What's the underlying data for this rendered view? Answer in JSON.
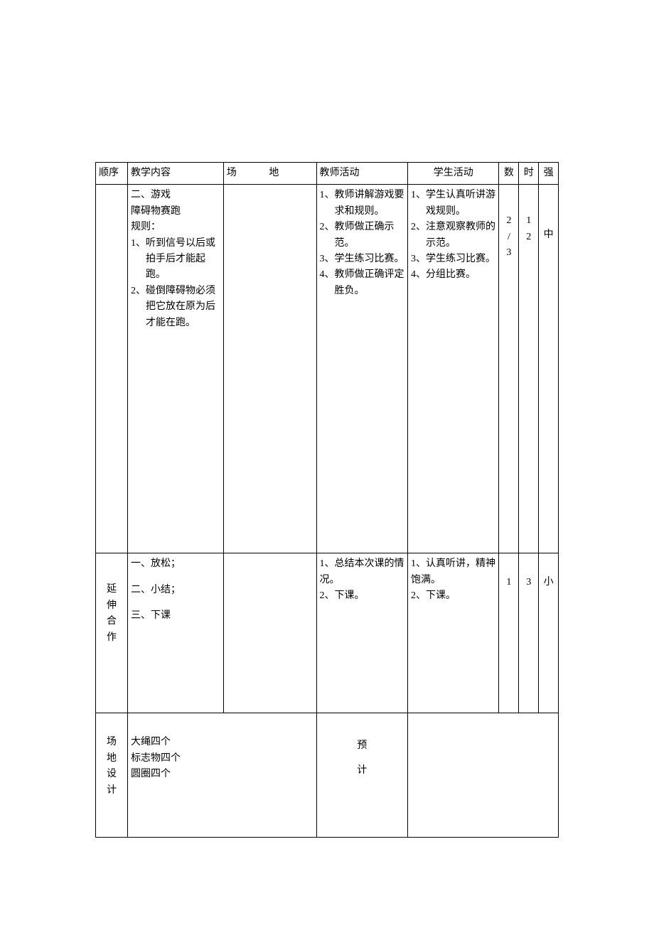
{
  "headers": {
    "seq": "顺序",
    "content": "教学内容",
    "field": "场   地",
    "teacher": "教师活动",
    "student": "学生活动",
    "num": "数",
    "time": "时",
    "inten": "强"
  },
  "row1": {
    "content": {
      "title": "二、游戏",
      "subtitle1": "障碍物赛跑",
      "subtitle2": "规则：",
      "items": [
        {
          "idx": "1、",
          "txt": "听到信号以后或拍手后才能起跑。"
        },
        {
          "idx": "2、",
          "txt": "碰倒障碍物必须把它放在原为后才能在跑。"
        }
      ]
    },
    "teacher": [
      {
        "idx": "1、",
        "txt": "教师讲解游戏要求和规则。"
      },
      {
        "idx": "2、",
        "txt": "教师做正确示范。"
      },
      {
        "idx": "3、",
        "txt": "学生练习比赛。"
      },
      {
        "idx": "4、",
        "txt": "教师做正确评定胜负。"
      }
    ],
    "student": [
      {
        "idx": "1、",
        "txt": "学生认真听讲游戏规则。"
      },
      {
        "idx": "2、",
        "txt": "注意观察教师的示范。"
      },
      {
        "idx": "3、",
        "txt": "学生练习比赛。"
      },
      {
        "idx": "4、",
        "txt": "分组比赛。"
      }
    ],
    "num": [
      "2",
      "/",
      "3"
    ],
    "time": [
      "1",
      "2"
    ],
    "inten": "中"
  },
  "row2": {
    "seq": [
      "延",
      "伸",
      "合",
      "作"
    ],
    "content": {
      "l1": "一、放松；",
      "l2": "二、小结；",
      "l3": "三、下课"
    },
    "teacher": {
      "l1": "1、总结本次课的情况。",
      "l2": "2、下课。"
    },
    "student": {
      "l1": "1、认真听讲，精神饱满。",
      "l2": "2、下课。"
    },
    "num": "1",
    "time": "3",
    "inten": "小"
  },
  "row3": {
    "seq": [
      "场",
      "地",
      "设",
      "计"
    ],
    "content": {
      "l1": "大绳四个",
      "l2": "标志物四个",
      "l3": "圆圈四个"
    },
    "predict_label_1": "预",
    "predict_label_2": "计"
  }
}
